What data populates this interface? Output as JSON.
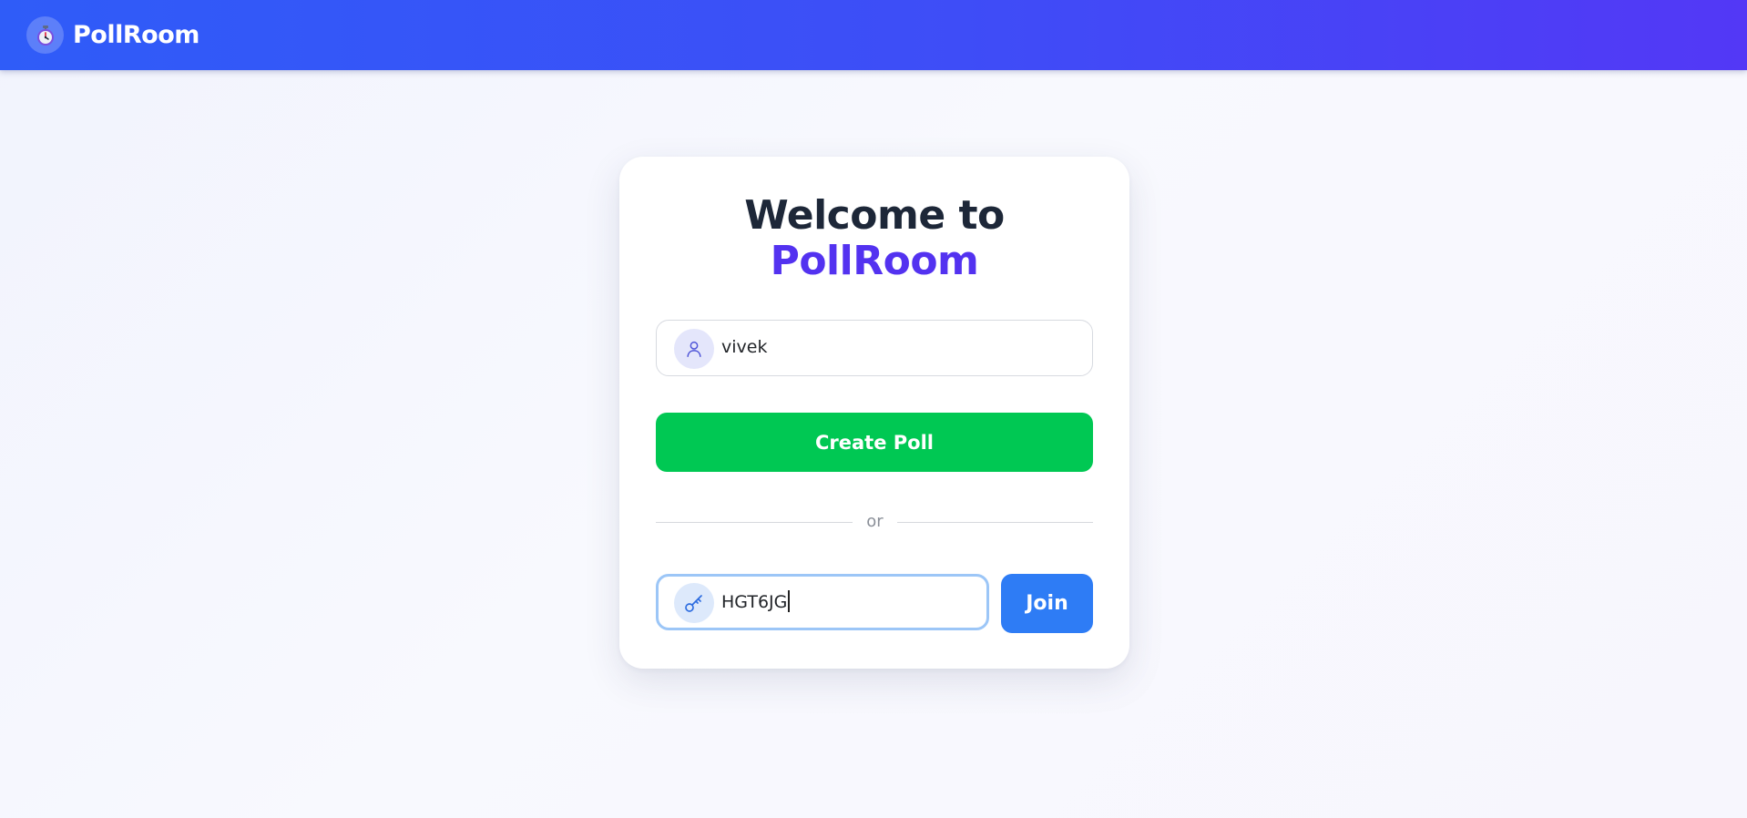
{
  "header": {
    "brand_name": "PollRoom",
    "logo_icon": "stopwatch-icon"
  },
  "card": {
    "title_line1": "Welcome to",
    "title_line2": "PollRoom",
    "name_field": {
      "value": "vivek",
      "icon": "user-icon"
    },
    "create_button_label": "Create Poll",
    "divider_text": "or",
    "code_field": {
      "value": "HGT6JG",
      "icon": "key-icon",
      "focused": true
    },
    "join_button_label": "Join"
  },
  "colors": {
    "header_gradient_start": "#2f5cf8",
    "header_gradient_end": "#5338f6",
    "title_dark": "#1d2738",
    "title_accent": "#5332f0",
    "create_button": "#00c853",
    "join_button": "#2e7cf5",
    "focus_border": "#9cc6f7"
  }
}
